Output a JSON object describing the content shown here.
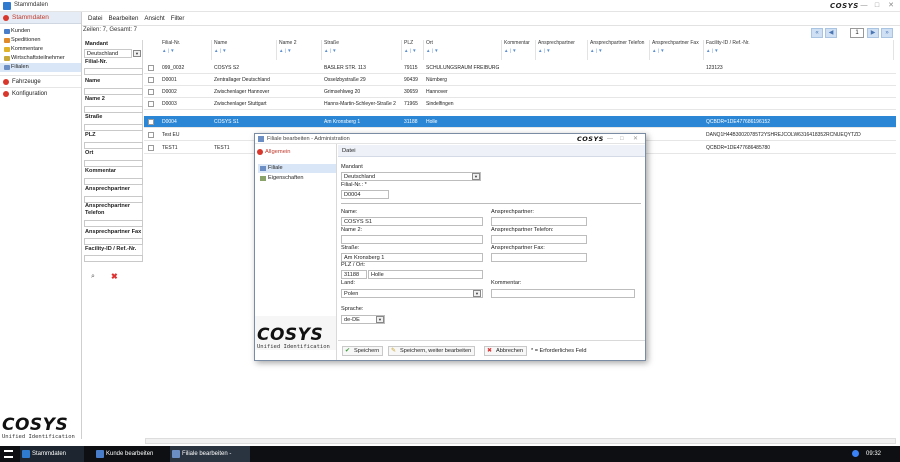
{
  "window": {
    "title": "Stammdaten",
    "brand": "COSYS",
    "minimize": "—",
    "maximize": "□",
    "close": "✕"
  },
  "sidebar": {
    "header": "Stammdaten",
    "items": [
      {
        "label": "Kunden",
        "color": "#4a7dc9"
      },
      {
        "label": "Speditionen",
        "color": "#e08a2b"
      },
      {
        "label": "Kommentare",
        "color": "#e0b32b"
      },
      {
        "label": "Wirtschaftsteilnehmer",
        "color": "#c9a83a"
      },
      {
        "label": "Filialen",
        "color": "#6b8fc4"
      }
    ],
    "groups": [
      "Fahrzeuge",
      "Konfiguration"
    ],
    "logo": "COSYS",
    "tagline": "Unified Identification"
  },
  "menu": [
    "Datei",
    "Bearbeiten",
    "Ansicht",
    "Filter"
  ],
  "info": "Zeilen: 7, Gesamt: 7",
  "pager": {
    "first": "«",
    "prev": "◀",
    "page": "1",
    "next": "▶",
    "last": "»"
  },
  "filter": {
    "mandant_label": "Mandant",
    "mandant_value": "Deutschland",
    "fields": [
      "Filial-Nr.",
      "Name",
      "Name 2",
      "Straße",
      "PLZ",
      "Ort",
      "Kommentar",
      "Ansprechpartner",
      "Ansprechpartner Telefon",
      "Ansprechpartner Fax",
      "Facility-ID / Ref.-Nr."
    ]
  },
  "grid": {
    "columns": [
      "Filial-Nr.",
      "Name",
      "Name 2",
      "Straße",
      "PLZ",
      "Ort",
      "Kommentar",
      "Ansprechpartner",
      "Ansprechpartner Telefon",
      "Ansprechpartner Fax",
      "Facility-ID / Ref.-Nr."
    ],
    "sort": "▲ | ▼",
    "rows": [
      {
        "nr": "099_0032",
        "name": "COSYS S2",
        "name2": "",
        "strasse": "BASLER STR. 113",
        "plz": "79115",
        "ort": "SCHULUNGSRAUM FREIBURG",
        "fid": "123123"
      },
      {
        "nr": "D0001",
        "name": "Zentrallager Deutschland",
        "name2": "",
        "strasse": "Osselzbystraße 29",
        "plz": "90439",
        "ort": "Nürnberg",
        "fid": ""
      },
      {
        "nr": "D0002",
        "name": "Zwischenlager Hannover",
        "name2": "",
        "strasse": "Grimsehlweg 20",
        "plz": "30659",
        "ort": "Hannover",
        "fid": ""
      },
      {
        "nr": "D0003",
        "name": "Zwischenlager Stuttgart",
        "name2": "",
        "strasse": "Hanns-Martin-Schleyer-Straße 2",
        "plz": "71965",
        "ort": "Sindelfingen",
        "fid": ""
      },
      {
        "nr": "D0004",
        "name": "COSYS S1",
        "name2": "",
        "strasse": "Am Kronsberg 1",
        "plz": "31188",
        "ort": "Holle",
        "fid": "QCBDR=1DE477686196152"
      },
      {
        "nr": "Test EU",
        "name": "",
        "name2": "",
        "strasse": "",
        "plz": "",
        "ort": "",
        "fid": "DANQ1H44B30020785T2YSHREJCOLW6316418352RCNUEQYTZD"
      },
      {
        "nr": "TEST1",
        "name": "TEST1",
        "name2": "",
        "strasse": "",
        "plz": "",
        "ort": "",
        "fid": "QCBDR=1DE477686485780"
      }
    ]
  },
  "dialog": {
    "title": "Filiale bearbeiten - Administration",
    "brand": "COSYS",
    "nav_header": "Allgemein",
    "nav_items": [
      "Filiale",
      "Eigenschaften"
    ],
    "menu": "Datei",
    "mandant_label": "Mandant",
    "mandant_value": "Deutschland",
    "filialnr_label": "Filial-Nr.: *",
    "filialnr_value": "D0004",
    "name_label": "Name:",
    "name_value": "COSYS S1",
    "name2_label": "Name 2:",
    "strasse_label": "Straße:",
    "strasse_value": "Am Kronsberg 1",
    "plzort_label": "PLZ / Ort:",
    "plz_value": "31188",
    "ort_value": "Holle",
    "land_label": "Land:",
    "land_value": "Polen",
    "sprache_label": "Sprache:",
    "sprache_value": "de-DE",
    "ap_label": "Ansprechpartner:",
    "aptel_label": "Ansprechpartner Telefon:",
    "apfax_label": "Ansprechpartner Fax:",
    "kommentar_label": "Kommentar:",
    "btn_save": "Speichern",
    "btn_save_continue": "Speichern, weiter bearbeiten",
    "btn_cancel": "Abbrechen",
    "required_note": "* = Erforderliches Feld",
    "logo": "COSYS",
    "tagline": "Unified Identification"
  },
  "taskbar": {
    "items": [
      "Stammdaten",
      "Kunde bearbeiten",
      "Filiale bearbeiten -"
    ],
    "time": "09:32"
  }
}
